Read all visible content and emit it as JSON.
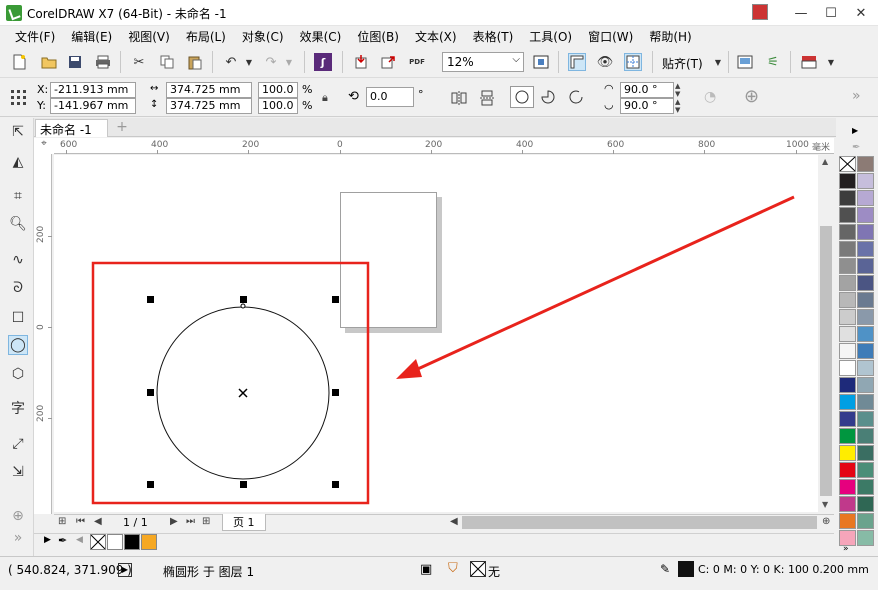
{
  "window": {
    "title": "CorelDRAW X7 (64-Bit) - 未命名 -1",
    "minimize": "—",
    "maximize": "☐",
    "close": "✕"
  },
  "menu": [
    "文件(F)",
    "编辑(E)",
    "视图(V)",
    "布局(L)",
    "对象(C)",
    "效果(C)",
    "位图(B)",
    "文本(X)",
    "表格(T)",
    "工具(O)",
    "窗口(W)",
    "帮助(H)"
  ],
  "toolbar": {
    "zoom_level": "12%",
    "snap_label": "贴齐(T)"
  },
  "propbar": {
    "x_label": "X:",
    "y_label": "Y:",
    "x_value": "-211.913 mm",
    "y_value": "-141.967 mm",
    "width_value": "374.725 mm",
    "height_value": "374.725 mm",
    "scale_x": "100.0",
    "scale_y": "100.0",
    "percent": "%",
    "rotation": "0.0",
    "degree": "°",
    "start_angle": "90.0 °",
    "end_angle": "90.0 °"
  },
  "document": {
    "tab_label": "未命名 -1",
    "ruler_unit": "毫米",
    "ruler_h_ticks": [
      "600",
      "400",
      "200",
      "0",
      "200",
      "400",
      "600",
      "800",
      "1000"
    ],
    "ruler_v_ticks": [
      "200",
      "0",
      "200"
    ]
  },
  "pagenav": {
    "page_count": "1 / 1",
    "page_tab": "页 1"
  },
  "status": {
    "cursor_position": "( 540.824, 371.909 )",
    "selection_info": "椭圆形 于 图层 1",
    "fill_label": "无",
    "outline_info": "C: 0 M: 0 Y: 0 K: 100  0.200 mm"
  },
  "colors": {
    "selection_highlight": "#e8231c",
    "annotation_arrow": "#e8231c",
    "accent_tool": "#cde6f7"
  },
  "palette": {
    "left_column": [
      "#ffffff",
      "#231f20",
      "#3d3d3d",
      "#505050",
      "#666666",
      "#7a7a7a",
      "#8f8f8f",
      "#a3a3a3",
      "#b8b8b8",
      "#cccccc",
      "#e0e0e0",
      "#f5f5f5",
      "#ffffff",
      "#1e2a7a",
      "#009fe3",
      "#333b8c",
      "#00963f",
      "#ffed00",
      "#e30613",
      "#e6007e",
      "#c0398b",
      "#e87722",
      "#f6a5ba"
    ],
    "right_column": [
      "#8c7b75",
      "#c6bedc",
      "#b6a9d3",
      "#9d8cc4",
      "#7f75b3",
      "#6972a8",
      "#5a6496",
      "#4b5583",
      "#6a7a90",
      "#8a99aa",
      "#4f92c6",
      "#3e7cb8",
      "#b0c4d0",
      "#90a7b3",
      "#708a96",
      "#5a8f8c",
      "#4a7f76",
      "#3a6e62",
      "#4a8e78",
      "#3c7a66",
      "#2f6754",
      "#6aa38d",
      "#87bba6"
    ]
  },
  "docker_swatches": [
    "none",
    "#ffffff",
    "#000000",
    "#f6a823"
  ]
}
